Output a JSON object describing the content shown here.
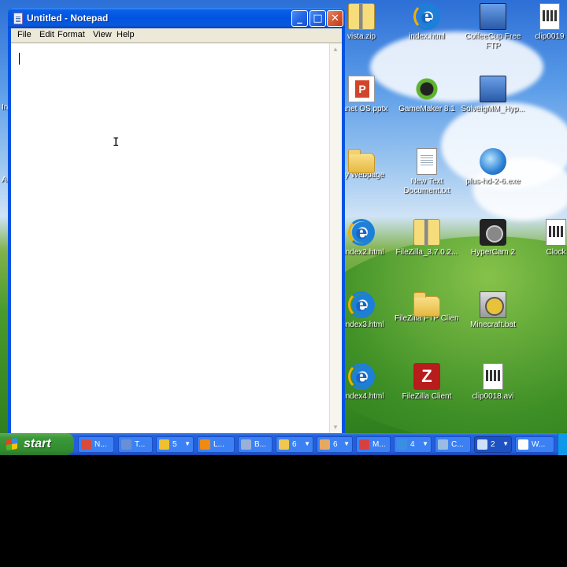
{
  "notepad": {
    "title": "Untitled - Notepad",
    "menu": [
      "File",
      "Edit",
      "Format",
      "View",
      "Help"
    ],
    "content": "",
    "controls": {
      "minimize": "_",
      "maximize": "□",
      "close": "✕"
    }
  },
  "desktop": {
    "icons": [
      {
        "label": "vista.zip",
        "icon": "zip-folder-icon"
      },
      {
        "label": "index.html",
        "icon": "internet-explorer-icon"
      },
      {
        "label": "CoffeeCup Free FTP",
        "icon": "coffeecup-ftp-icon"
      },
      {
        "label": "clip0019",
        "icon": "avi-file-icon"
      },
      {
        "label": "...anet OS.pptx",
        "icon": "powerpoint-file-icon"
      },
      {
        "label": "GameMaker 8.1",
        "icon": "gamemaker-icon"
      },
      {
        "label": "SolveigMM_Hyp...",
        "icon": "solveig-installer-icon"
      },
      {
        "label": "...y Webpage",
        "icon": "folder-icon"
      },
      {
        "label": "New Text Document.txt",
        "icon": "text-document-icon"
      },
      {
        "label": "plus-hd-2-6.exe",
        "icon": "globe-exe-icon"
      },
      {
        "label": "...ndex2.html",
        "icon": "internet-explorer-icon"
      },
      {
        "label": "FileZilla_3.7.0.2...",
        "icon": "zip-folder-icon"
      },
      {
        "label": "HyperCam 2",
        "icon": "hypercam-icon"
      },
      {
        "label": "Clock",
        "icon": "clock-file-icon"
      },
      {
        "label": "...ndex3.html",
        "icon": "internet-explorer-icon"
      },
      {
        "label": "FileZilla FTP Client",
        "icon": "folder-icon"
      },
      {
        "label": "Minecraft.bat",
        "icon": "batch-file-icon"
      },
      {
        "label": "...ndex4.html",
        "icon": "internet-explorer-icon"
      },
      {
        "label": "FileZilla Client",
        "icon": "filezilla-icon"
      },
      {
        "label": "clip0018.avi",
        "icon": "avi-file-icon"
      }
    ],
    "left_edge_fragments": [
      "In",
      "A"
    ]
  },
  "taskbar": {
    "start_label": "start",
    "buttons": [
      {
        "label": "N...",
        "icon": "notepad-icon",
        "color": "#d94a3a"
      },
      {
        "label": "T...",
        "icon": "window-icon",
        "color": "#6a8fd4"
      },
      {
        "label": "5",
        "icon": "chat-icon",
        "color": "#f0c030",
        "dropdown": "▼"
      },
      {
        "label": "L...",
        "icon": "orange-circle-icon",
        "color": "#f08a10"
      },
      {
        "label": "B...",
        "icon": "tools-icon",
        "color": "#9ab0d8"
      },
      {
        "label": "6",
        "icon": "folder-icon",
        "color": "#f0c850",
        "dropdown": "▼"
      },
      {
        "label": "6",
        "icon": "hand-icon",
        "color": "#e8a860",
        "dropdown": "▼"
      },
      {
        "label": "M...",
        "icon": "email-icon",
        "color": "#d84040"
      },
      {
        "label": "4",
        "icon": "ie-icon",
        "color": "#3a90e0",
        "dropdown": "▼"
      },
      {
        "label": "C...",
        "icon": "settings-icon",
        "color": "#9abce0"
      },
      {
        "label": "2",
        "icon": "notepad-icon",
        "color": "#cfe0f8",
        "dropdown": "▼",
        "active": true
      },
      {
        "label": "W...",
        "icon": "camera-icon",
        "color": "#ffffff"
      }
    ]
  }
}
